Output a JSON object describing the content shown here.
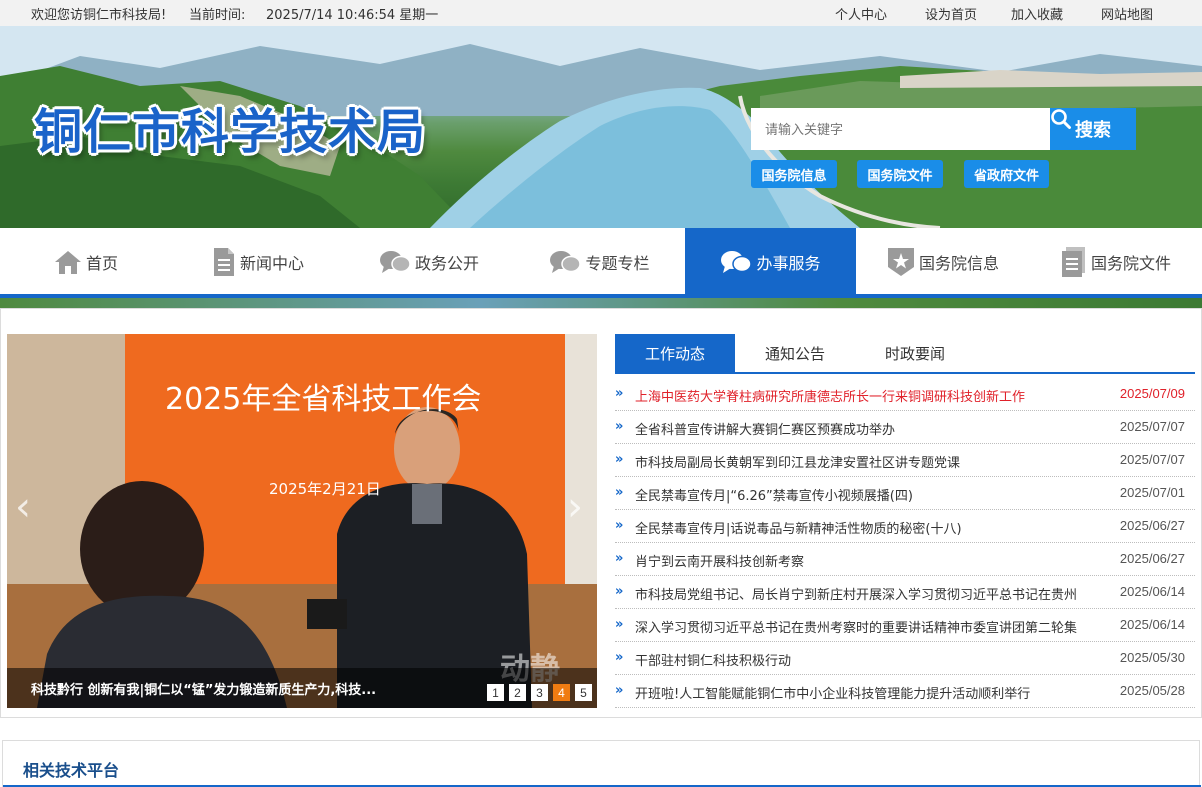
{
  "topbar": {
    "welcome": "欢迎您访铜仁市科技局!",
    "time_label": "当前时间:",
    "time_value": "2025/7/14 10:46:54 星期一",
    "links": [
      "个人中心",
      "设为首页",
      "加入收藏",
      "网站地图"
    ]
  },
  "header": {
    "site_title": "铜仁市科学技术局",
    "search": {
      "placeholder": "请输入关键字",
      "button_label": "搜索"
    },
    "quick_links": [
      "国务院信息",
      "国务院文件",
      "省政府文件"
    ]
  },
  "nav": {
    "items": [
      {
        "label": "首页",
        "icon": "home-icon"
      },
      {
        "label": "新闻中心",
        "icon": "document-icon"
      },
      {
        "label": "政务公开",
        "icon": "chat-icon"
      },
      {
        "label": "专题专栏",
        "icon": "chat-icon"
      },
      {
        "label": "办事服务",
        "icon": "chat-icon"
      },
      {
        "label": "国务院信息",
        "icon": "badge-star-icon"
      },
      {
        "label": "国务院文件",
        "icon": "file-icon"
      }
    ],
    "active": "办事服务"
  },
  "slider": {
    "banner_text": "2025年全省科技工作会",
    "banner_date": "2025年2月21日",
    "watermark": "动静",
    "caption": "科技黔行 创新有我|铜仁以“锰”发力锻造新质生产力,科技...",
    "pages": [
      "1",
      "2",
      "3",
      "4",
      "5"
    ],
    "current_page": "4"
  },
  "news": {
    "tabs": [
      "工作动态",
      "通知公告",
      "时政要闻"
    ],
    "active_tab": "工作动态",
    "items": [
      {
        "title": "上海中医药大学脊柱病研究所唐德志所长一行来铜调研科技创新工作",
        "date": "2025/07/09"
      },
      {
        "title": "全省科普宣传讲解大赛铜仁赛区预赛成功举办",
        "date": "2025/07/07"
      },
      {
        "title": "市科技局副局长黄朝军到印江县龙津安置社区讲专题党课",
        "date": "2025/07/07"
      },
      {
        "title": "全民禁毒宣传月|“6.26”禁毒宣传小视频展播(四)",
        "date": "2025/07/01"
      },
      {
        "title": "全民禁毒宣传月|话说毒品与新精神活性物质的秘密(十八)",
        "date": "2025/06/27"
      },
      {
        "title": "肖宁到云南开展科技创新考察",
        "date": "2025/06/27"
      },
      {
        "title": "市科技局党组书记、局长肖宁到新庄村开展深入学习贯彻习近平总书记在贵州",
        "date": "2025/06/14"
      },
      {
        "title": "深入学习贯彻习近平总书记在贵州考察时的重要讲话精神市委宣讲团第二轮集",
        "date": "2025/06/14"
      },
      {
        "title": "干部驻村铜仁科技积极行动",
        "date": "2025/05/30"
      },
      {
        "title": "开班啦!人工智能赋能铜仁市中小企业科技管理能力提升活动顺利举行",
        "date": "2025/05/28"
      }
    ]
  },
  "platform": {
    "title": "相关技术平台"
  },
  "colors": {
    "primary": "#1567c9",
    "accent": "#1a8de8",
    "hot": "#e0212a",
    "slider_page_on": "#f07c12"
  }
}
